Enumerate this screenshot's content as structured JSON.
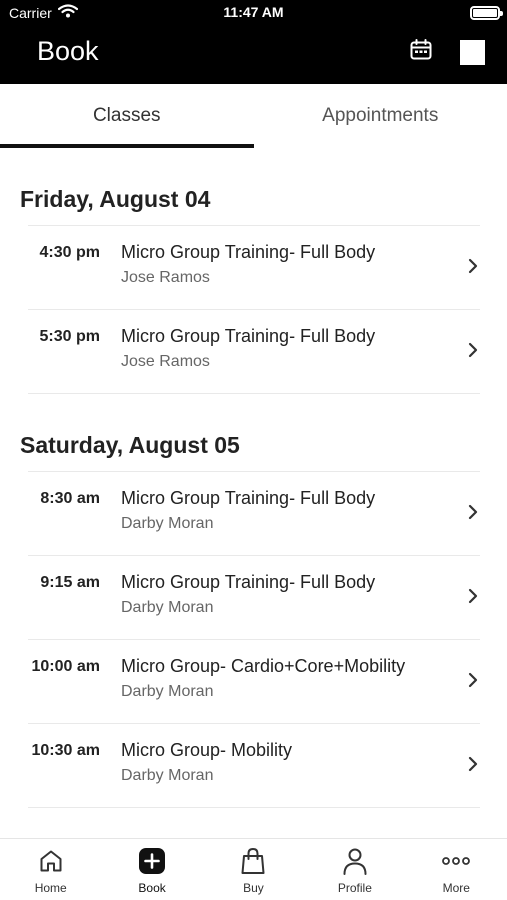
{
  "status": {
    "carrier": "Carrier",
    "time": "11:47 AM"
  },
  "header": {
    "title": "Book",
    "icons": [
      "calendar-icon",
      "square-icon"
    ]
  },
  "tabs": [
    {
      "label": "Classes",
      "active": true
    },
    {
      "label": "Appointments",
      "active": false
    }
  ],
  "schedule": [
    {
      "date": "Friday, August 04",
      "classes": [
        {
          "time": "4:30 pm",
          "name": "Micro Group Training- Full Body",
          "instructor": "Jose Ramos"
        },
        {
          "time": "5:30 pm",
          "name": "Micro Group Training- Full Body",
          "instructor": "Jose Ramos"
        }
      ]
    },
    {
      "date": "Saturday, August 05",
      "classes": [
        {
          "time": "8:30 am",
          "name": "Micro Group Training- Full Body",
          "instructor": "Darby Moran"
        },
        {
          "time": "9:15 am",
          "name": "Micro Group Training- Full Body",
          "instructor": "Darby Moran"
        },
        {
          "time": "10:00 am",
          "name": "Micro Group- Cardio+Core+Mobility",
          "instructor": "Darby Moran"
        },
        {
          "time": "10:30 am",
          "name": "Micro Group- Mobility",
          "instructor": "Darby Moran"
        }
      ]
    }
  ],
  "tabbar": [
    {
      "label": "Home",
      "icon": "home-icon"
    },
    {
      "label": "Book",
      "icon": "plus-square-icon",
      "active": true
    },
    {
      "label": "Buy",
      "icon": "shopping-bag-icon"
    },
    {
      "label": "Profile",
      "icon": "person-icon"
    },
    {
      "label": "More",
      "icon": "ellipsis-icon"
    }
  ],
  "colors": {
    "header_bg": "#000000",
    "text_primary": "#222222",
    "text_secondary": "#666666",
    "divider": "#e9e9e9"
  }
}
